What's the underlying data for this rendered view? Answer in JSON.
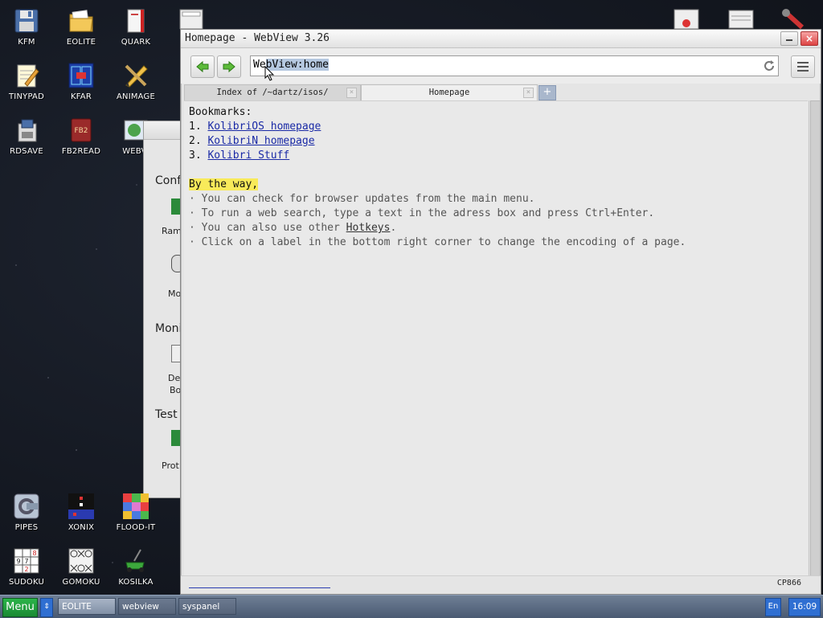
{
  "desktop": {
    "icons_top": [
      {
        "label": "KFM",
        "icon": "floppy-icon"
      },
      {
        "label": "EOLITE",
        "icon": "folder-icon"
      },
      {
        "label": "QUARK",
        "icon": "notebook-icon"
      },
      {
        "label": "TINYPAD",
        "icon": "notepad-icon"
      },
      {
        "label": "KFAR",
        "icon": "kfar-icon"
      },
      {
        "label": "ANIMAGE",
        "icon": "pencil-icon"
      },
      {
        "label": "RDSAVE",
        "icon": "disk-save-icon"
      },
      {
        "label": "FB2READ",
        "icon": "book-icon"
      },
      {
        "label": "WEBVI",
        "icon": "webview-icon"
      }
    ],
    "icons_bottom": [
      {
        "label": "PIPES",
        "icon": "pipes-icon"
      },
      {
        "label": "XONIX",
        "icon": "xonix-icon"
      },
      {
        "label": "FLOOD-IT",
        "icon": "flood-it-icon"
      },
      {
        "label": "SUDOKU",
        "icon": "sudoku-icon"
      },
      {
        "label": "GOMOKU",
        "icon": "gomoku-icon"
      },
      {
        "label": "KOSILKA",
        "icon": "lawnmower-icon"
      }
    ]
  },
  "syspanel": {
    "section1": "Conf",
    "item1": "Ram",
    "item2": "Mo",
    "section2": "Moni",
    "item3a": "De",
    "item3b": "Bo",
    "section3": "Test",
    "item4": "Prot"
  },
  "window": {
    "title": "Homepage - WebView 3.26",
    "address_value": "WebView:home",
    "address_plain": "We",
    "address_selected": "bView:home",
    "tabs": [
      {
        "label": "Index of /~dartz/isos/",
        "active": false
      },
      {
        "label": "Homepage",
        "active": true
      }
    ],
    "tab_add": "+",
    "close_glyph": "×",
    "content": {
      "bookmarks_header": "Bookmarks:",
      "bookmarks": [
        {
          "num": "1. ",
          "text": "KolibriOS homepage"
        },
        {
          "num": "2. ",
          "text": "KolibriN homepage"
        },
        {
          "num": "3. ",
          "text": "Kolibri Stuff"
        }
      ],
      "btw": "By the way,",
      "tips": [
        "· You can check for browser updates from the main menu.",
        "· To run a web search, type a text in the adress box and press Ctrl+Enter.",
        "· You can also use other ",
        "· Click on a label in the bottom right corner to change the encoding of a page."
      ],
      "hotkeys_link": "Hotkeys",
      "hotkeys_suffix": "."
    },
    "encoding": "CP866"
  },
  "taskbar": {
    "menu": "Menu",
    "arrows": "⇕",
    "tasks": [
      {
        "label": "EOLITE",
        "active": true
      },
      {
        "label": "webview",
        "active": false
      },
      {
        "label": "syspanel",
        "active": false
      }
    ],
    "lang": "En",
    "clock": "16:09"
  },
  "colors": {
    "accent": "#2f6fd2",
    "menu_green": "#1a8a33",
    "link": "#1a2aa6",
    "highlight": "#f8ea5a"
  }
}
